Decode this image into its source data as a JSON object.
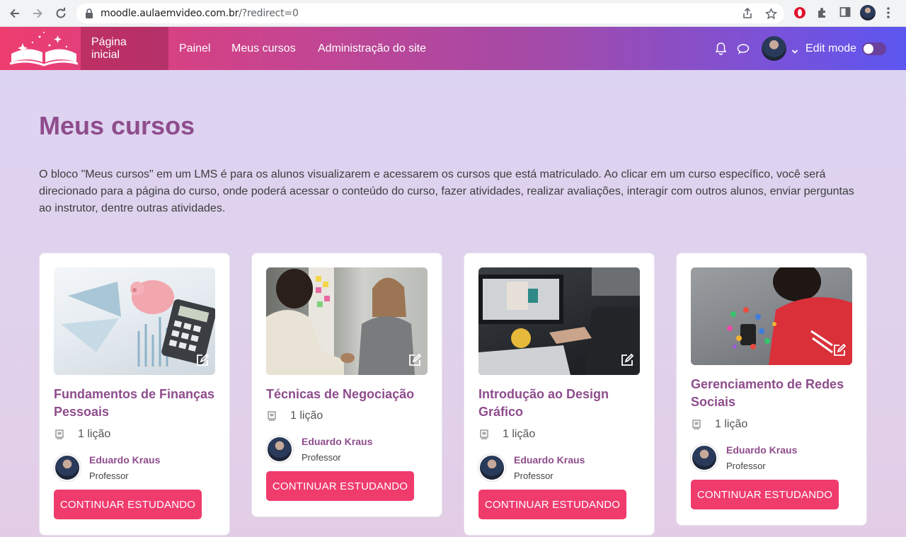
{
  "browser": {
    "url_host": "moodle.aulaemvideo.com.br",
    "url_path": "/?redirect=0",
    "icons": [
      "back-icon",
      "forward-icon",
      "reload-icon",
      "lock-icon",
      "share-icon",
      "star-icon",
      "opera-icon",
      "puzzle-icon",
      "sidebar-icon",
      "profile-icon",
      "menu-dots-icon"
    ]
  },
  "navbar": {
    "items": [
      "Página inicial",
      "Painel",
      "Meus cursos",
      "Administração do site"
    ],
    "active": "Página inicial",
    "edit_mode_label": "Edit mode",
    "edit_mode_on": false,
    "gradient": [
      "#ee3d6f",
      "#5c56f0"
    ]
  },
  "page": {
    "title": "Meus cursos",
    "description": "O bloco \"Meus cursos\" em um LMS é para os alunos visualizarem e acessarem os cursos que está matriculado. Ao clicar em um curso específico, você será direcionado para a página do curso, onde poderá acessar o conteúdo do curso, fazer atividades, realizar avaliações, interagir com outros alunos, enviar perguntas ao instrutor, dentre outras atividades."
  },
  "courses": [
    {
      "title": "Fundamentos de Finanças Pessoais",
      "lessons": "1 lição",
      "teacher": "Eduardo Kraus",
      "role": "Professor",
      "button": "CONTINUAR ESTUDANDO"
    },
    {
      "title": "Técnicas de Negociação",
      "lessons": "1 lição",
      "teacher": "Eduardo Kraus",
      "role": "Professor",
      "button": "CONTINUAR ESTUDANDO"
    },
    {
      "title": "Introdução ao Design Gráfico",
      "lessons": "1 lição",
      "teacher": "Eduardo Kraus",
      "role": "Professor",
      "button": "CONTINUAR ESTUDANDO"
    },
    {
      "title": "Gerenciamento de Redes Sociais",
      "lessons": "1 lição",
      "teacher": "Eduardo Kraus",
      "role": "Professor",
      "button": "CONTINUAR ESTUDANDO"
    }
  ],
  "colors": {
    "accent": "#8e4c8c",
    "button": "#f03b6d"
  }
}
